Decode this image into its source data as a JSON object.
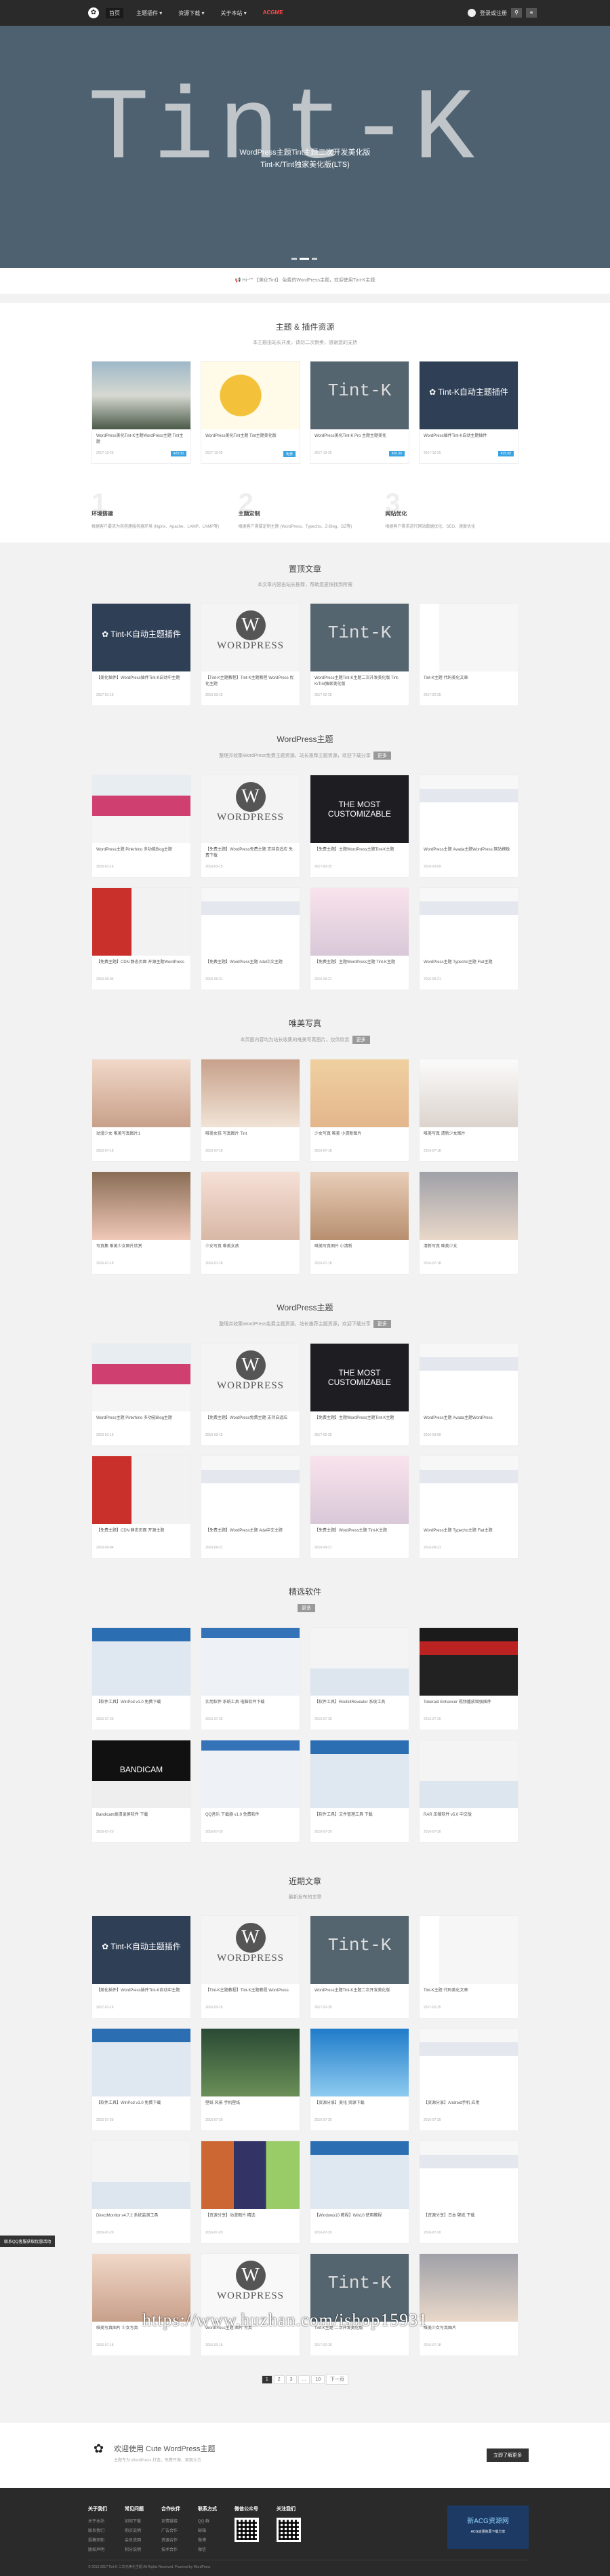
{
  "nav": {
    "items": [
      {
        "label": "首页",
        "active": true,
        "hot": false
      },
      {
        "label": "主题插件 ▾",
        "active": false,
        "hot": false
      },
      {
        "label": "资源下载 ▾",
        "active": false,
        "hot": false
      },
      {
        "label": "关于本站 ▾",
        "active": false,
        "hot": false
      },
      {
        "label": "ACGME",
        "active": false,
        "hot": true
      }
    ],
    "login": "登录或注册"
  },
  "hero": {
    "bigtext": "Tint-K",
    "caption1": "WordPress主题Tint主题二次开发美化版",
    "caption2": "Tint-K/Tint独家美化版(LTS)"
  },
  "notice": "📢 Hi~\"\" 【美化Tint】 免费的WordPress主题，欢迎使用Tint-K主题",
  "themes": {
    "title": "主题 & 插件资源",
    "subtitle": "本主题由站长开发，请勿二次倒卖，感谢您的支持",
    "cards": [
      {
        "title": "WordPress美化Tint-K主题WordPress主题 Tint主题",
        "meta": "2017-12-25",
        "price": "¥20.00",
        "style": "beach"
      },
      {
        "title": "WordPress美化Tint主题 Tint主题美化版",
        "meta": "2017-12-25",
        "price": "免费",
        "style": "coins"
      },
      {
        "title": "WordPress美化Tint-K Pro 主题主题美化",
        "meta": "2017-12-25",
        "price": "¥20.00",
        "style": "tintk"
      },
      {
        "title": "WordPress插件Tint-K自动主题插件",
        "meta": "2017-12-25",
        "price": "¥15.00",
        "style": "tintk-plug"
      }
    ]
  },
  "features": [
    {
      "num": "1",
      "title": "环境搭建",
      "desc": "根据客户要求为其搭建服务器环境 (Nginx、Apache、LAMP、LNMP等)"
    },
    {
      "num": "2",
      "title": "主题定制",
      "desc": "根据客户需要定制主题 (WordPress、Typecho、Z-Blog、DZ等)"
    },
    {
      "num": "3",
      "title": "网站优化",
      "desc": "根据客户需求进行网站数据优化、SEO、速度优化"
    }
  ],
  "hotposts": {
    "title": "置顶文章",
    "subtitle": "本文章内容由站长推荐，帮助您更快找到所需",
    "cards": [
      {
        "title": "【美化插件】WordPress插件Tint-K自动中主题",
        "meta": "2017-01-19",
        "style": "tintk-plug"
      },
      {
        "title": "【Tint-K主题教程】Tint-K主题教程 WordPress 优化主题",
        "meta": "2016-03-15",
        "style": "wp"
      },
      {
        "title": "WordPress主题Tint-K主题二次开发美化版 Tint-K/Tint独家美化版",
        "meta": "2017-02-25",
        "style": "tintk"
      },
      {
        "title": "Tint-K主题 代码美化文章",
        "meta": "2017-02-25",
        "style": "code"
      }
    ]
  },
  "wp1": {
    "title": "WordPress主题",
    "subtitle": "整理并收集WordPress免费主题资源，站长推荐主题资源，欢迎下载分享",
    "more": "更多",
    "cards": [
      {
        "title": "WordPress主题 Pinkrhino 多功能Blog主题",
        "meta": "2016-01-16",
        "style": "site-blue"
      },
      {
        "title": "【免费主题】WordPress免费主题 支持自适应 免费下载",
        "meta": "2016-03-15",
        "style": "wp"
      },
      {
        "title": "【免费主题】主题WordPress主题Tint-K主题",
        "meta": "2017-02-25",
        "style": "dark"
      },
      {
        "title": "WordPress主题 Avada主题WordPress 网站模板",
        "meta": "2016-03-09",
        "style": "site-white"
      },
      {
        "title": "【免费主题】CDN 静态页面 开源主题WordPress",
        "meta": "2016-09-04",
        "style": "site-red"
      },
      {
        "title": "【免费主题】WordPress主题 Ada中文主题",
        "meta": "2016-09-21",
        "style": "site-white"
      },
      {
        "title": "【免费主题】主题WordPress主题 Tint-K主题",
        "meta": "2016-09-21",
        "style": "site-pink"
      },
      {
        "title": "WordPress主题 Typecho主题 Flat主题",
        "meta": "2016-09-21",
        "style": "site-white"
      }
    ]
  },
  "photos": {
    "title": "唯美写真",
    "subtitle": "本页面内容均为站长收集的唯美写真图片，仅供欣赏",
    "more": "更多",
    "cards": [
      {
        "title": "动漫少女 唯美写真图片1",
        "meta": "2016-07-18",
        "style": "p1"
      },
      {
        "title": "唯美女孩 写真图片 Tint",
        "meta": "2016-07-18",
        "style": "p2"
      },
      {
        "title": "少女写真 唯美 小清新图片",
        "meta": "2016-07-18",
        "style": "p3"
      },
      {
        "title": "唯美写真 清新少女图片",
        "meta": "2016-07-18",
        "style": "p4"
      },
      {
        "title": "写真集 唯美少女图片欣赏",
        "meta": "2016-07-18",
        "style": "p5"
      },
      {
        "title": "少女写真 唯美女孩",
        "meta": "2016-07-18",
        "style": "p6"
      },
      {
        "title": "唯美写真图片 小清新",
        "meta": "2016-07-18",
        "style": "p7"
      },
      {
        "title": "清新写真 唯美少女",
        "meta": "2016-07-18",
        "style": "p8"
      }
    ]
  },
  "wp2": {
    "title": "WordPress主题",
    "subtitle": "整理并收集WordPress免费主题资源，站长推荐主题资源，欢迎下载分享",
    "more": "更多",
    "cards": [
      {
        "title": "WordPress主题 Pinkrhino 多功能Blog主题",
        "meta": "2016-01-16",
        "style": "site-blue"
      },
      {
        "title": "【免费主题】WordPress免费主题 支持自适应",
        "meta": "2016-03-15",
        "style": "wp"
      },
      {
        "title": "【免费主题】主题WordPress主题Tint-K主题",
        "meta": "2017-02-25",
        "style": "dark"
      },
      {
        "title": "WordPress主题 Avada主题WordPress",
        "meta": "2016-03-09",
        "style": "site-white"
      },
      {
        "title": "【免费主题】CDN 静态页面 开源主题",
        "meta": "2016-09-04",
        "style": "site-red"
      },
      {
        "title": "【免费主题】WordPress主题 Ada中文主题",
        "meta": "2016-09-21",
        "style": "site-white"
      },
      {
        "title": "【免费主题】WordPress主题 Tint-K主题",
        "meta": "2016-09-21",
        "style": "site-pink"
      },
      {
        "title": "WordPress主题 Typecho主题 Flat主题",
        "meta": "2016-09-21",
        "style": "site-white"
      }
    ]
  },
  "software": {
    "title": "精选软件",
    "more": "更多",
    "cards": [
      {
        "title": "【软件工具】WinPcd v1.0 免费下载",
        "meta": "2016-07-20",
        "style": "win"
      },
      {
        "title": "实用软件 系统工具 电脑软件下载",
        "meta": "2016-07-20",
        "style": "win2"
      },
      {
        "title": "【软件工具】RootkitRevealer 系统工具",
        "meta": "2016-07-20",
        "style": "win3"
      },
      {
        "title": "Tekeraid Enhancer 视频播放增强插件",
        "meta": "2016-07-20",
        "style": "yt"
      },
      {
        "title": "Bandicam高清录屏软件 下载",
        "meta": "2016-07-20",
        "style": "bandi"
      },
      {
        "title": "QQ音乐 下载器 v1.0 免费软件",
        "meta": "2016-07-20",
        "style": "win2"
      },
      {
        "title": "【软件工具】文件管理工具 下载",
        "meta": "2016-07-20",
        "style": "win"
      },
      {
        "title": "RAR 压缩软件 v5.0 中文版",
        "meta": "2016-07-20",
        "style": "win3"
      }
    ]
  },
  "recent": {
    "title": "近期文章",
    "subtitle": "最新发布的文章",
    "cards": [
      {
        "title": "【美化插件】WordPress插件Tint-K自动中主题",
        "meta": "2017-01-19",
        "style": "tintk-plug"
      },
      {
        "title": "【Tint-K主题教程】Tint-K主题教程 WordPress",
        "meta": "2016-03-15",
        "style": "wp"
      },
      {
        "title": "WordPress主题Tint-K主题二次开发美化版",
        "meta": "2017-02-25",
        "style": "tintk"
      },
      {
        "title": "Tint-K主题 代码美化文章",
        "meta": "2017-02-25",
        "style": "code"
      },
      {
        "title": "【软件工具】WinPcd v1.0 免费下载",
        "meta": "2016-07-20",
        "style": "win"
      },
      {
        "title": "壁纸 风景 手机壁纸",
        "meta": "2016-07-20",
        "style": "green"
      },
      {
        "title": "【资源分享】美化 资源下载",
        "meta": "2016-07-20",
        "style": "blue-app"
      },
      {
        "title": "【资源分享】Android手机 应用",
        "meta": "2016-07-20",
        "style": "site-white"
      },
      {
        "title": "DirectMonitor v4.7.2 系统监测工具",
        "meta": "2016-07-20",
        "style": "win3"
      },
      {
        "title": "【资源分享】动漫图片 精选",
        "meta": "2016-07-20",
        "style": "collage"
      },
      {
        "title": "【Windows10 教程】Win10 使用教程",
        "meta": "2016-07-20",
        "style": "win"
      },
      {
        "title": "【资源分享】日本 壁纸 下载",
        "meta": "2016-07-20",
        "style": "site-white"
      },
      {
        "title": "唯美写真图片 少女写真",
        "meta": "2016-07-18",
        "style": "p1"
      },
      {
        "title": "WordPress主题 图片 写真",
        "meta": "2016-03-15",
        "style": "wp-light"
      },
      {
        "title": "Tint-K主题 二次开发美化版",
        "meta": "2017-02-25",
        "style": "tintk"
      },
      {
        "title": "唯美少女写真图片",
        "meta": "2016-07-18",
        "style": "p8"
      }
    ]
  },
  "pager": [
    "1",
    "2",
    "3",
    "...",
    "10",
    "下一页"
  ],
  "welcome": {
    "title": "欢迎使用 Cute WordPress主题",
    "desc": "主题专为 WordPress 打造，免费开源，美观大方",
    "button": "立即了解更多"
  },
  "side_tag": "联系QQ客服获取优惠活动",
  "footer": {
    "cols": [
      {
        "head": "关于我们",
        "items": [
          "关于本站",
          "联系我们",
          "投稿须知",
          "版权声明"
        ]
      },
      {
        "head": "常见问题",
        "items": [
          "如何下载",
          "购买说明",
          "会员说明",
          "积分说明"
        ]
      },
      {
        "head": "合作伙伴",
        "items": [
          "友情链接",
          "广告合作",
          "资源合作",
          "技术合作"
        ]
      },
      {
        "head": "联系方式",
        "items": [
          "QQ 群",
          "邮箱",
          "微博",
          "微信"
        ]
      },
      {
        "head": "微信公众号",
        "items": []
      },
      {
        "head": "关注我们",
        "items": []
      }
    ],
    "ad_title": "新ACG资源网",
    "ad_sub": "ACG动漫资源下载分享",
    "copyright": "© 2016-2017  Tint-K 二次元美化主题 All Rights Reserved.  Powered by WordPress"
  },
  "watermark": "https://www.huzhan.com/ishop15931"
}
